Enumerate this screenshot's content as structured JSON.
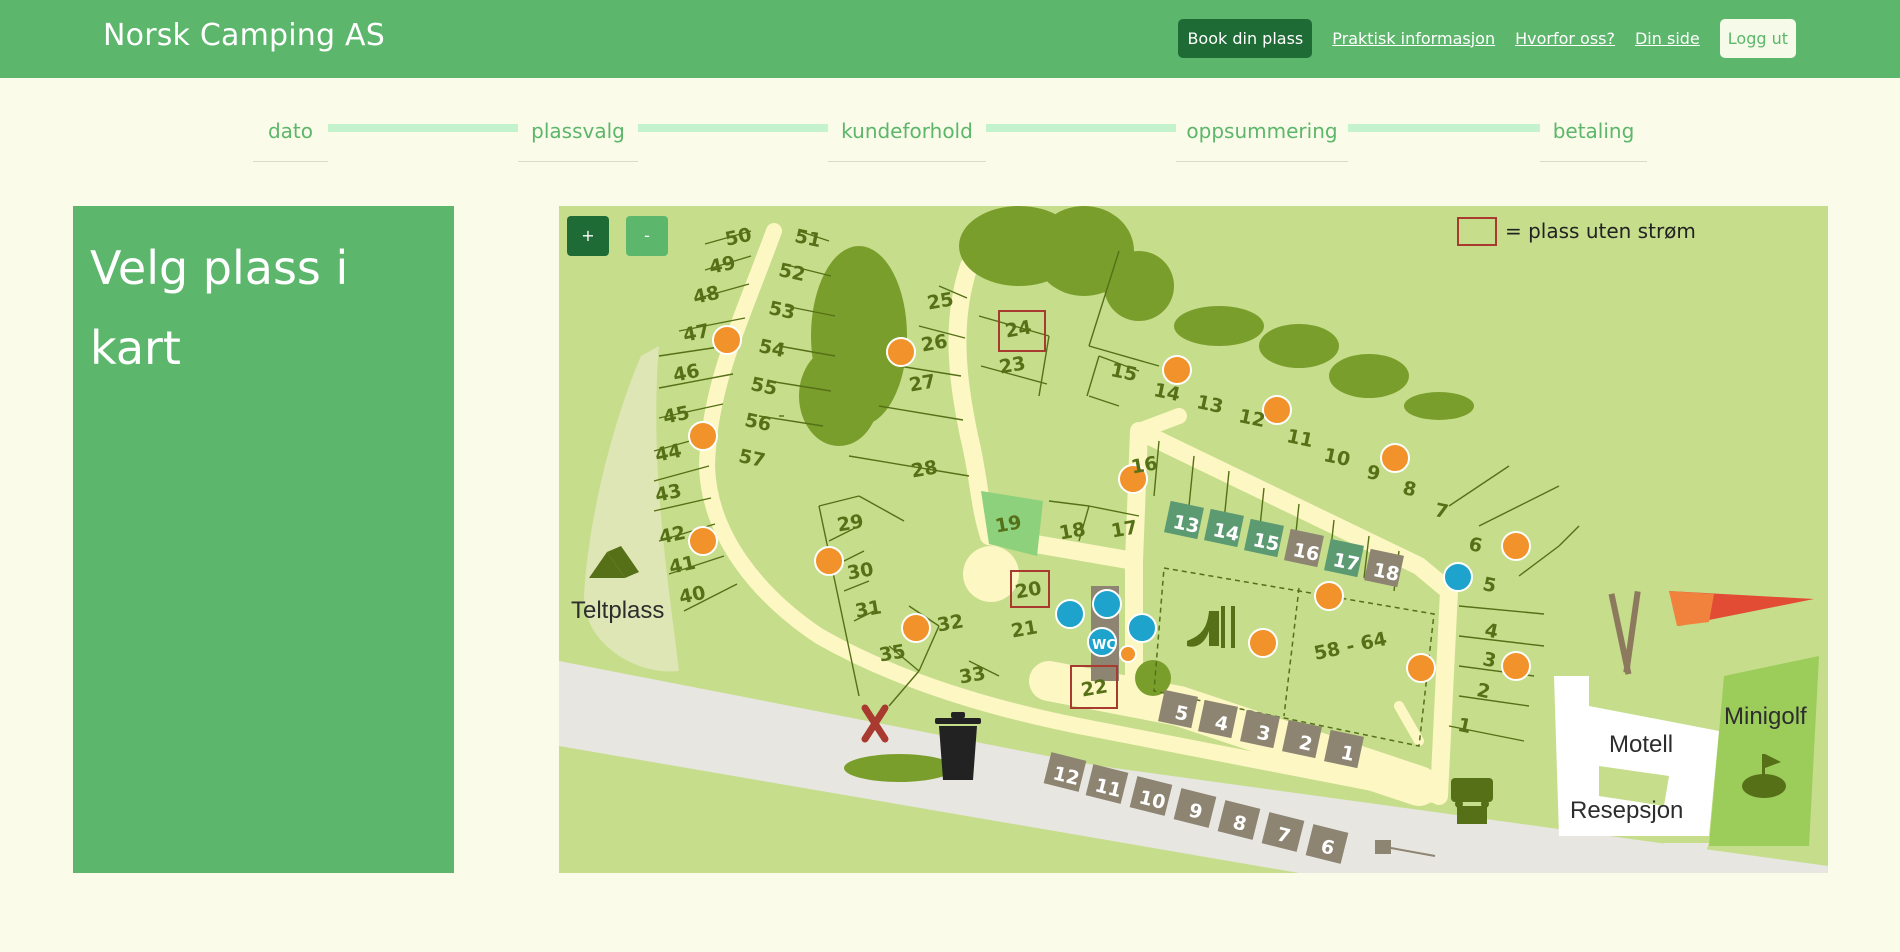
{
  "header": {
    "brand": "Norsk Camping AS",
    "book_label": "Book din plass",
    "links": [
      "Praktisk informasjon",
      "Hvorfor oss?",
      "Din side"
    ],
    "logout_label": "Logg ut"
  },
  "steps": [
    "dato",
    "plassvalg",
    "kundeforhold",
    "oppsummering",
    "betaling"
  ],
  "panel": {
    "title": "Velg plass i kart"
  },
  "map": {
    "zoom_in": "+",
    "zoom_out": "-",
    "legend_label": "= plass uten strøm",
    "labels": {
      "teltplass": "Teltplass",
      "motell": "Motell",
      "resepsjon": "Resepsjon",
      "minigolf": "Minigolf",
      "wc": "WC",
      "field": "58 - 64"
    },
    "colors": {
      "grass": "#c6dd8c",
      "road": "#fdf7c3",
      "trees": "#7a9e2c",
      "pitch_dark": "#8d8472",
      "pitch_teal": "#5c9a72",
      "power": "#f2922a",
      "water": "#1ea3cd",
      "no_power_border": "#a83a2f"
    },
    "sites": [
      "1",
      "2",
      "3",
      "4",
      "5",
      "6",
      "7",
      "8",
      "9",
      "10",
      "11",
      "12",
      "13",
      "14",
      "15",
      "16",
      "17",
      "18",
      "19",
      "20",
      "21",
      "22",
      "23",
      "24",
      "25",
      "26",
      "27",
      "28",
      "29",
      "30",
      "31",
      "32",
      "33",
      "35",
      "40",
      "41",
      "42",
      "43",
      "44",
      "45",
      "46",
      "47",
      "48",
      "49",
      "50",
      "51",
      "52",
      "53",
      "54",
      "55",
      "56",
      "57"
    ],
    "pitches": [
      "1",
      "2",
      "3",
      "4",
      "5",
      "6",
      "7",
      "8",
      "9",
      "10",
      "11",
      "12",
      "13",
      "14",
      "15",
      "16",
      "17",
      "18"
    ],
    "no_power_sites": [
      "20",
      "22",
      "24"
    ]
  }
}
